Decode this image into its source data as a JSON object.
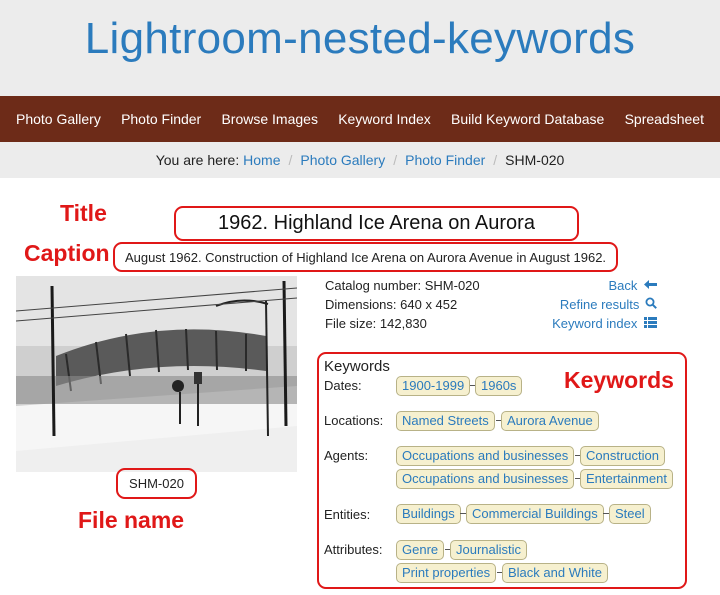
{
  "site": {
    "title": "Lightroom-nested-keywords"
  },
  "nav": {
    "items": [
      "Photo Gallery",
      "Photo Finder",
      "Browse Images",
      "Keyword Index",
      "Build Keyword Database",
      "Spreadsheet"
    ]
  },
  "breadcrumb": {
    "prefix": "You are here:",
    "links": [
      "Home",
      "Photo Gallery",
      "Photo Finder"
    ],
    "current": "SHM-020"
  },
  "annotations": {
    "title": "Title",
    "caption": "Caption",
    "keywords": "Keywords",
    "file_name": "File name"
  },
  "photo": {
    "title": "1962. Highland Ice Arena on Aurora",
    "caption": "August 1962. Construction of Highland Ice Arena on Aurora Avenue in August 1962.",
    "file_name": "SHM-020"
  },
  "metadata": {
    "catalog_number": "Catalog number: SHM-020",
    "dimensions": "Dimensions: 640 x 452",
    "file_size": "File size: 142,830"
  },
  "actions": {
    "back": "Back",
    "refine": "Refine results",
    "keyword_index": "Keyword index"
  },
  "keywords": {
    "heading": "Keywords",
    "labels": {
      "dates": "Dates:",
      "locations": "Locations:",
      "agents": "Agents:",
      "entities": "Entities:",
      "attributes": "Attributes:"
    },
    "dates": [
      "1900-1999",
      "1960s"
    ],
    "locations": [
      "Named Streets",
      "Aurora Avenue"
    ],
    "agents_1": [
      "Occupations and businesses",
      "Construction"
    ],
    "agents_2": [
      "Occupations and businesses",
      "Entertainment"
    ],
    "entities": [
      "Buildings",
      "Commercial Buildings",
      "Steel"
    ],
    "attributes_1": [
      "Genre",
      "Journalistic"
    ],
    "attributes_2": [
      "Print properties",
      "Black and White"
    ]
  },
  "colors": {
    "link": "#2b7bbd",
    "nav_bg": "#6d2b18",
    "annotation": "#e01818",
    "tag_bg": "#f6f0cf"
  }
}
